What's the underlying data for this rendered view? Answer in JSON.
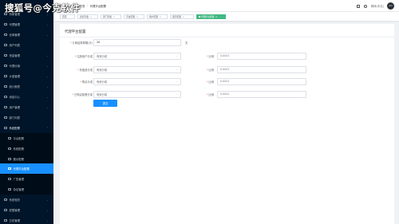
{
  "watermark": "搜狐号@今克软件",
  "sidebar": {
    "items": [
      {
        "label": "商家管理",
        "expandable": true
      },
      {
        "label": "代理管理",
        "expandable": true
      },
      {
        "label": "仓库管理",
        "expandable": true
      },
      {
        "label": "用户列表",
        "expandable": false
      },
      {
        "label": "资金管理",
        "expandable": true
      },
      {
        "label": "代理分销",
        "expandable": true
      },
      {
        "label": "计费管理",
        "expandable": true
      },
      {
        "label": "统计报表",
        "expandable": true
      },
      {
        "label": "消息中心",
        "expandable": true
      },
      {
        "label": "用户管理",
        "expandable": true
      },
      {
        "label": "部门列表",
        "expandable": false
      },
      {
        "label": "系统配置",
        "expandable": true,
        "open": true
      },
      {
        "label": "平台配置",
        "sub": true
      },
      {
        "label": "系统配置",
        "sub": true
      },
      {
        "label": "展示配置",
        "sub": true
      },
      {
        "label": "代理平台配置",
        "sub": true,
        "active": true
      },
      {
        "label": "广告管理",
        "sub": true
      },
      {
        "label": "协议管理",
        "sub": true
      },
      {
        "label": "系统相关",
        "expandable": true
      },
      {
        "label": "权限管理",
        "expandable": true
      },
      {
        "label": "日志管理",
        "expandable": true
      }
    ]
  },
  "header": {
    "breadcrumb": [
      "首页",
      "系统配置",
      "代理平台配置"
    ],
    "lang_label": "简体(中文)",
    "avatar_text": "Am"
  },
  "tags": [
    {
      "label": "首页"
    },
    {
      "label": "商家列表"
    },
    {
      "label": "部门列表"
    },
    {
      "label": "平台配置"
    },
    {
      "label": "用户配置"
    },
    {
      "label": "展示配置"
    },
    {
      "label": "代理平台配置",
      "active": true
    }
  ],
  "form": {
    "title": "代理平台配置",
    "timeout_label": "订单结算周期(天)",
    "timeout_value": "20",
    "timeout_unit": "天",
    "rows": [
      {
        "label": "注册用户分成",
        "select": "有效分成",
        "ratio_label": "比例",
        "ratio_placeholder": "0.0001"
      },
      {
        "label": "充值费分成",
        "select": "有效分成",
        "ratio_label": "比例",
        "ratio_placeholder": "0.0001"
      },
      {
        "label": "购买分成",
        "select": "有效分成",
        "ratio_label": "比例",
        "ratio_placeholder": "0.0001"
      },
      {
        "label": "已购买套餐分成",
        "select": "有效分成",
        "ratio_label": "比例",
        "ratio_placeholder": "0.0001"
      }
    ],
    "submit_label": "提交"
  }
}
